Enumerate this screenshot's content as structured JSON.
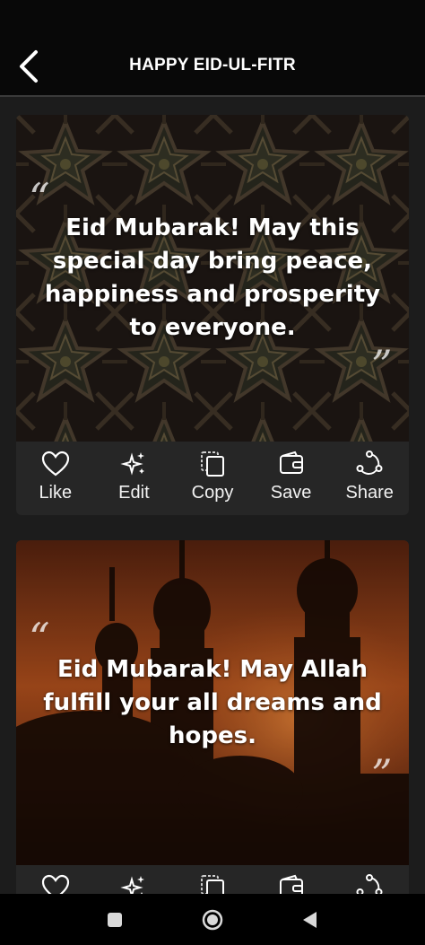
{
  "header": {
    "title": "HAPPY EID-UL-FITR",
    "back_icon": "back-arrow-icon"
  },
  "cards": [
    {
      "quote": "Eid Mubarak! May this special day bring peace, happiness and prosperity to everyone.",
      "open_mark": "“",
      "close_mark": "”",
      "background": "ornate-islamic-geometric-ceiling"
    },
    {
      "quote": "Eid Mubarak! May Allah fulfill your all dreams and hopes.",
      "open_mark": "“",
      "close_mark": "”",
      "background": "mosque-silhouette-sunset"
    }
  ],
  "actions": {
    "like": "Like",
    "edit": "Edit",
    "copy": "Copy",
    "save": "Save",
    "share": "Share"
  },
  "colors": {
    "app_bar": "#080808",
    "background": "#1c1c1c",
    "card": "#262626",
    "text": "#ffffff"
  },
  "system_nav": {
    "buttons": [
      "recents-icon",
      "home-icon",
      "back-triangle-icon"
    ]
  }
}
